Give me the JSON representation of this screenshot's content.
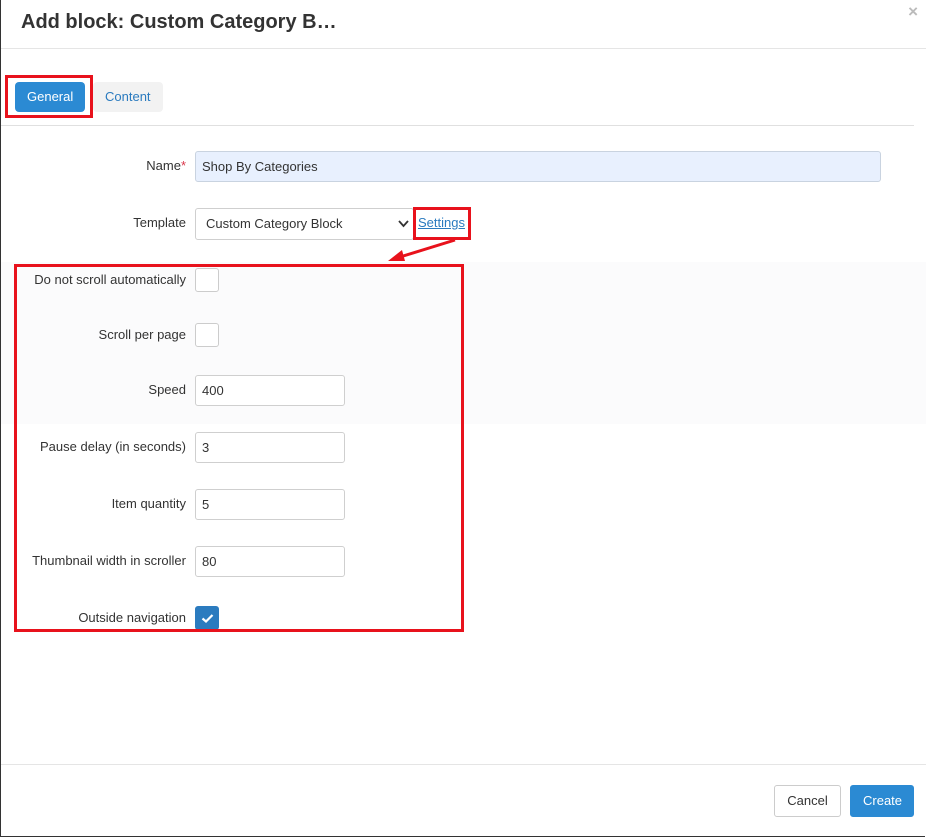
{
  "dialog": {
    "title": "Add block: Custom Category B…",
    "close_glyph": "×"
  },
  "tabs": [
    {
      "label": "General",
      "active": true
    },
    {
      "label": "Content",
      "active": false
    }
  ],
  "form": {
    "name": {
      "label": "Name",
      "required_mark": "*",
      "value": "Shop By Categories"
    },
    "template": {
      "label": "Template",
      "selected": "Custom Category Block",
      "settings_link": "Settings"
    },
    "do_not_scroll": {
      "label": "Do not scroll automatically",
      "checked": false
    },
    "scroll_per_page": {
      "label": "Scroll per page",
      "checked": false
    },
    "speed": {
      "label": "Speed",
      "value": "400"
    },
    "pause_delay": {
      "label": "Pause delay (in seconds)",
      "value": "3"
    },
    "item_quantity": {
      "label": "Item quantity",
      "value": "5"
    },
    "thumbnail_width": {
      "label": "Thumbnail width in scroller",
      "value": "80"
    },
    "outside_navigation": {
      "label": "Outside navigation",
      "checked": true
    }
  },
  "footer": {
    "cancel_label": "Cancel",
    "create_label": "Create"
  },
  "colors": {
    "accent": "#2b8ad3",
    "annotation": "#e8121c",
    "link": "#2b7bbf"
  }
}
